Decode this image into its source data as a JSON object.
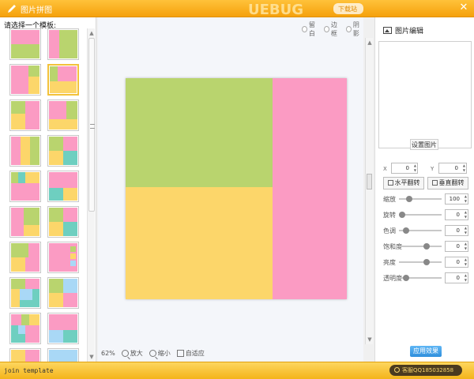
{
  "window": {
    "title": "图片拼图",
    "close_symbol": "✕",
    "watermark": "UEBUG 下载站"
  },
  "left_panel": {
    "prompt": "请选择一个模板:",
    "selected_index": 3,
    "colors": {
      "pink": "#fb9bc3",
      "green": "#b9d46e",
      "yellow": "#fcd66a",
      "teal": "#6ecfc0",
      "blue": "#a9d8f6"
    }
  },
  "options": [
    {
      "label": "留白"
    },
    {
      "label": "边框"
    },
    {
      "label": "阴影"
    }
  ],
  "preview_colors": {
    "top_left": "#b9d46e",
    "bottom_left": "#fcd66a",
    "right": "#fb9bc3"
  },
  "zoom": {
    "level": "62%",
    "zoom_in": "放大",
    "zoom_out": "缩小",
    "fit": "自适应"
  },
  "right_panel": {
    "header": "图片编辑",
    "set_image": "设置图片",
    "x_label": "X",
    "x_value": "0",
    "y_label": "Y",
    "y_value": "0",
    "flip_horizontal": "水平翻转",
    "flip_vertical": "垂直翻转",
    "sliders": [
      {
        "label": "缩放",
        "value": "100",
        "level": 0.18
      },
      {
        "label": "旋转",
        "value": "0",
        "level": 0.0
      },
      {
        "label": "色调",
        "value": "0",
        "level": 0.1
      },
      {
        "label": "饱和度",
        "value": "0",
        "level": 0.62
      },
      {
        "label": "亮度",
        "value": "0",
        "level": 0.62
      },
      {
        "label": "透明度",
        "value": "0",
        "level": 0.1
      }
    ],
    "apply": "应用效果"
  },
  "status": {
    "text": "join template",
    "support": "客服QQ185032858"
  }
}
